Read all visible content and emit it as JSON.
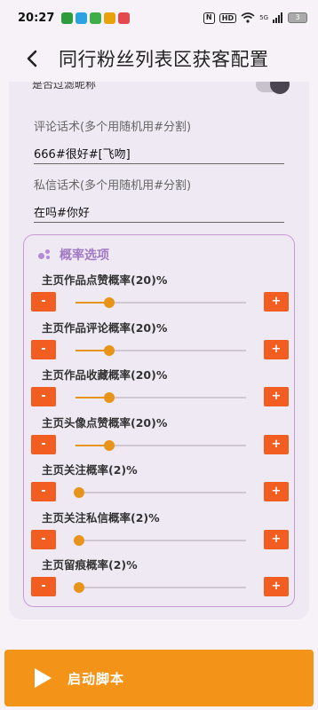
{
  "status_bar": {
    "time": "20:27",
    "battery": "3",
    "hd": "HD",
    "nfc": "N",
    "signal": "5G"
  },
  "header": {
    "title": "同行粉丝列表区获客配置"
  },
  "form": {
    "filter_nickname_label": "是否过滤昵称",
    "comment_label": "评论话术(多个用随机用#分割)",
    "comment_value": "666#很好#[飞吻]",
    "message_label": "私信话术(多个用随机用#分割)",
    "message_value": "在吗#你好"
  },
  "probability": {
    "title": "概率选项",
    "minus": "-",
    "plus": "+",
    "items": [
      {
        "label": "主页作品点赞概率(20)%",
        "value": 20
      },
      {
        "label": "主页作品评论概率(20)%",
        "value": 20
      },
      {
        "label": "主页作品收藏概率(20)%",
        "value": 20
      },
      {
        "label": "主页头像点赞概率(20)%",
        "value": 20
      },
      {
        "label": "主页关注概率(2)%",
        "value": 2
      },
      {
        "label": "主页关注私信概率(2)%",
        "value": 2
      },
      {
        "label": "主页留痕概率(2)%",
        "value": 2
      }
    ]
  },
  "start_button": {
    "label": "启动脚本"
  },
  "colors": {
    "accent_orange": "#f39418",
    "button_red": "#f25d22",
    "purple": "#a27ac6"
  }
}
